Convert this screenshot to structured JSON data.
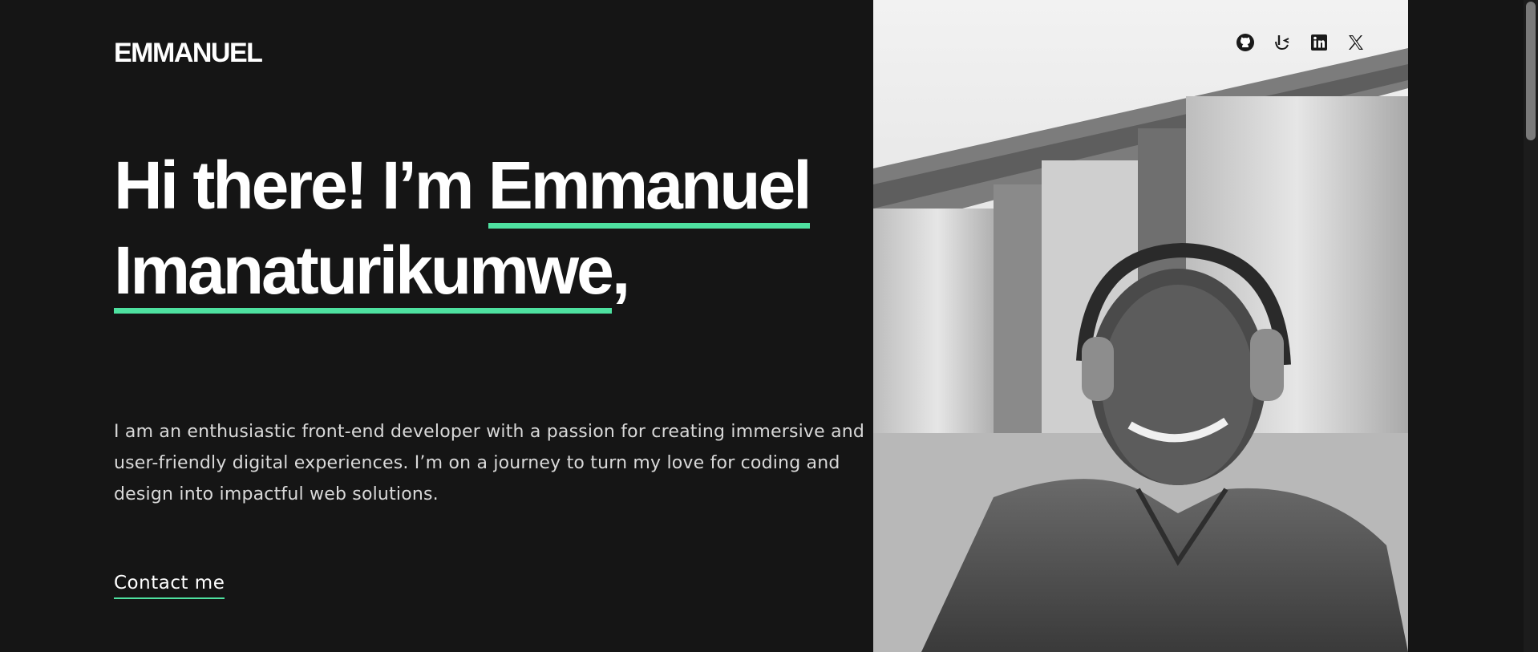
{
  "header": {
    "logo": "EMMANUEL"
  },
  "hero": {
    "greeting": "Hi there! I’m ",
    "name_line1": "Emmanuel",
    "name_line2": "Imanaturikumwe",
    "name_suffix": ",",
    "intro": "I am an enthusiastic front-end developer with a passion for creating immersive and user-friendly digital experiences. I’m on a journey to turn my love for coding and design into impactful web solutions.",
    "cta_label": "Contact me"
  },
  "socials": [
    {
      "icon": "github-icon"
    },
    {
      "icon": "frontend-mentor-icon"
    },
    {
      "icon": "linkedin-icon"
    },
    {
      "icon": "x-twitter-icon"
    }
  ],
  "colors": {
    "background": "#151515",
    "accent": "#4ee1a0",
    "text": "#ffffff"
  }
}
